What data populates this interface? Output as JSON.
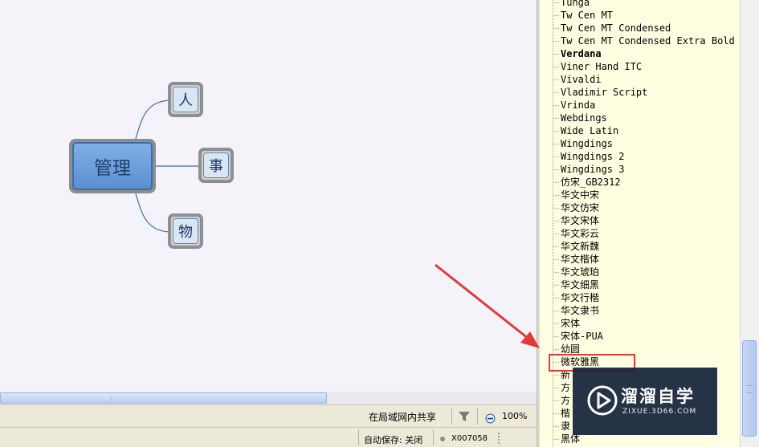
{
  "mindmap": {
    "root": "管理",
    "children": [
      "人",
      "事",
      "物"
    ]
  },
  "fonts": [
    "Tunga",
    "Tw Cen MT",
    "Tw Cen MT Condensed",
    "Tw Cen MT Condensed Extra Bold",
    "Verdana",
    "Viner Hand ITC",
    "Vivaldi",
    "Vladimir Script",
    "Vrinda",
    "Webdings",
    "Wide Latin",
    "Wingdings",
    "Wingdings 2",
    "Wingdings 3",
    "仿宋_GB2312",
    "华文中宋",
    "华文仿宋",
    "华文宋体",
    "华文彩云",
    "华文新魏",
    "华文楷体",
    "华文琥珀",
    "华文细黑",
    "华文行楷",
    "华文隶书",
    "宋体",
    "宋体-PUA",
    "幼圆",
    "微软雅黑",
    "新",
    "方",
    "方",
    "楷",
    "隶",
    "黑体"
  ],
  "font_list": {
    "bold_item": "Verdana",
    "highlighted_item": "微软雅黑"
  },
  "status": {
    "share": "在局域网内共享",
    "zoom": "100%",
    "autosave": "自动保存: 关闭",
    "code": "X007058"
  },
  "watermark": {
    "title": "溜溜自学",
    "url": "ZIXUE.3D66.COM"
  },
  "colors": {
    "annotation": "#e03a3a",
    "panel_bg": "#ffffe1",
    "root_node": "#6a9ad6",
    "canvas_bg": "#f3f3f9"
  }
}
